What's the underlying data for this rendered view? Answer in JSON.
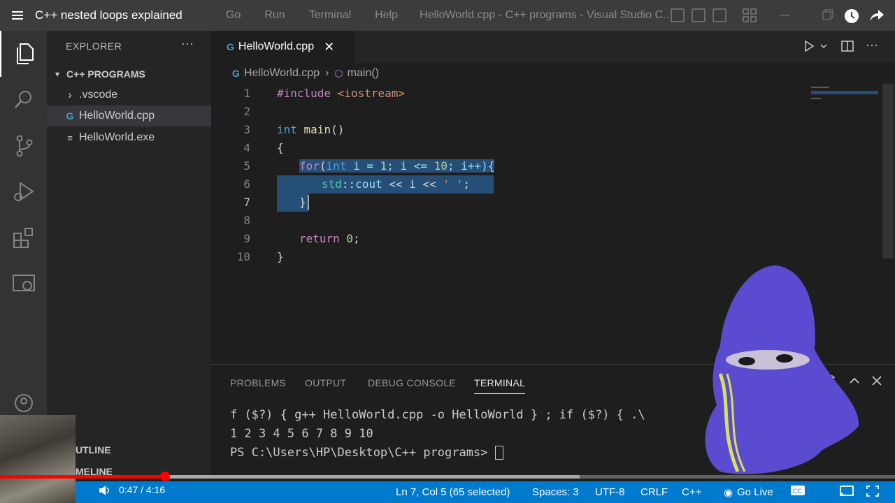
{
  "video_title": "C++ nested loops explained",
  "menu": [
    "Go",
    "Run",
    "Terminal",
    "Help"
  ],
  "window_title": "HelloWorld.cpp - C++ programs - Visual Studio C...",
  "sidebar": {
    "title": "EXPLORER",
    "more": "···",
    "folder": "C++ PROGRAMS",
    "items": [
      {
        "label": ".vscode",
        "icon": "chevron-right-icon",
        "glyph": "›"
      },
      {
        "label": "HelloWorld.cpp",
        "icon": "cpp-file-icon",
        "glyph": "G"
      },
      {
        "label": "HelloWorld.exe",
        "icon": "exe-file-icon",
        "glyph": "≡"
      }
    ],
    "outline_label": "UTLINE",
    "timeline_label": "MELINE"
  },
  "tab": {
    "label": "HelloWorld.cpp",
    "close": "✕"
  },
  "breadcrumb": {
    "file": "HelloWorld.cpp",
    "sep": "›",
    "symbol": "main()"
  },
  "code_lines": [
    "1",
    "2",
    "3",
    "4",
    "5",
    "6",
    "7",
    "8",
    "9",
    "10"
  ],
  "code": {
    "l1_pp": "#include",
    "l1_str": " <iostream>",
    "l3_kw": "int",
    "l3_fn": " main",
    "l3_rest": "()",
    "l4": "{",
    "l5_kw": "for",
    "l5_a": "(",
    "l5_int": "int",
    "l5_b": " i = ",
    "l5_n1": "1",
    "l5_c": "; i <= ",
    "l5_n2": "10",
    "l5_d": "; i++){",
    "l6_ns": "std",
    "l6_a": "::",
    "l6_cout": "cout",
    "l6_b": " << i << ",
    "l6_str": "' '",
    "l6_c": ";",
    "l7": "}",
    "l9_kw": "return",
    "l9_n": " 0",
    "l9_c": ";",
    "l10": "}"
  },
  "panel": {
    "tabs": [
      "PROBLEMS",
      "OUTPUT",
      "DEBUG CONSOLE",
      "TERMINAL"
    ],
    "terminal": [
      "f ($?) { g++ HelloWorld.cpp -o HelloWorld } ; if ($?) { .\\",
      "1 2 3 4 5 6 7 8 9 10",
      "PS C:\\Users\\HP\\Desktop\\C++ programs> "
    ]
  },
  "statusbar": {
    "position": "Ln 7, Col 5 (65 selected)",
    "spaces": "Spaces: 3",
    "encoding": "UTF-8",
    "eol": "CRLF",
    "language": "C++",
    "go_live": "Go Live"
  },
  "video": {
    "time": "0:47 / 4:16",
    "progress": 0.184,
    "buffered": 0.648
  }
}
